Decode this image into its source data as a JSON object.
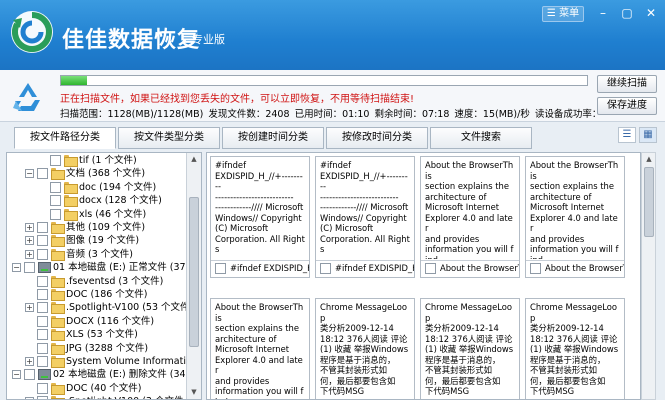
{
  "app": {
    "name": "佳佳数据恢复",
    "edition": "专业版",
    "menu_label": "菜单",
    "window_controls": [
      "minimize-icon",
      "maximize-icon",
      "close-icon"
    ]
  },
  "colors": {
    "titlebar": "#1f7fd0",
    "warning": "#d01414",
    "progress": "#2fb52f"
  },
  "scan": {
    "progress_fraction": 0.05,
    "warning": "正在扫描文件，如果已经找到您丢失的文件，可以立即恢复，不用等待扫描结束!",
    "stats": [
      "扫描范围：1128(MB)/1128(MB)",
      "发现文件数：2408",
      "已用时间：01:10",
      "剩余时间：07:18",
      "速度：15(MB)/秒",
      "读设备成功率："
    ],
    "continue_label": "继续扫描",
    "save_progress_label": "保存进度"
  },
  "tabs": [
    "按文件路径分类",
    "按文件类型分类",
    "按创建时间分类",
    "按修改时间分类",
    "文件搜索"
  ],
  "active_tab": 0,
  "view_icons": [
    "list-view-icon",
    "thumbnail-view-icon"
  ],
  "tree": [
    {
      "label": "tif  (1 个文件)",
      "icon": "folder",
      "depth": 3,
      "expand": ""
    },
    {
      "label": "文档  (368 个文件)",
      "icon": "folder",
      "depth": 2,
      "expand": "−"
    },
    {
      "label": "doc  (194 个文件)",
      "icon": "folder",
      "depth": 3,
      "expand": ""
    },
    {
      "label": "docx  (128 个文件)",
      "icon": "folder",
      "depth": 3,
      "expand": ""
    },
    {
      "label": "xls  (46 个文件)",
      "icon": "folder",
      "depth": 3,
      "expand": ""
    },
    {
      "label": "其他  (109 个文件)",
      "icon": "folder",
      "depth": 2,
      "expand": "+"
    },
    {
      "label": "图像  (19 个文件)",
      "icon": "folder",
      "depth": 2,
      "expand": "+"
    },
    {
      "label": "音频  (3 个文件)",
      "icon": "folder",
      "depth": 2,
      "expand": "+"
    },
    {
      "label": "01 本地磁盘 (E:) 正常文件 (37",
      "icon": "drive",
      "depth": 1,
      "expand": "−"
    },
    {
      "label": ".fseventsd  (3 个文件)",
      "icon": "folder",
      "depth": 2,
      "expand": ""
    },
    {
      "label": "DOC  (186 个文件)",
      "icon": "folder",
      "depth": 2,
      "expand": ""
    },
    {
      "label": ".Spotlight-V100  (53 个文件",
      "icon": "folder",
      "depth": 2,
      "expand": "+"
    },
    {
      "label": "DOCX  (116 个文件)",
      "icon": "folder",
      "depth": 2,
      "expand": ""
    },
    {
      "label": "XLS  (53 个文件)",
      "icon": "folder",
      "depth": 2,
      "expand": ""
    },
    {
      "label": "JPG  (3288 个文件)",
      "icon": "folder",
      "depth": 2,
      "expand": ""
    },
    {
      "label": "System Volume Information",
      "icon": "folder",
      "depth": 2,
      "expand": "+"
    },
    {
      "label": "02 本地磁盘 (E:) 删除文件 (34",
      "icon": "drive",
      "depth": 1,
      "expand": "−"
    },
    {
      "label": "DOC  (40 个文件)",
      "icon": "folder",
      "depth": 2,
      "expand": ""
    },
    {
      "label": ".Spotlight-V100  (3 个文件",
      "icon": "folder",
      "depth": 2,
      "expand": "+"
    }
  ],
  "files": [
    {
      "preview": "#ifndef\nEXDISPID_H_//+---------\n--------------------------\n------------//// Microsoft\nWindows// Copyright\n(C) Microsoft\nCorporation. All Rights",
      "name": "#ifndef EXDISPID_H_"
    },
    {
      "preview": "#ifndef\nEXDISPID_H_//+---------\n--------------------------\n------------//// Microsoft\nWindows// Copyright\n(C) Microsoft\nCorporation. All Rights",
      "name": "#ifndef EXDISPID_H_"
    },
    {
      "preview": "About the BrowserThis\nsection explains the\narchitecture of\nMicrosoft Internet\nExplorer 4.0 and later\nand provides\ninformation you will find\nhelpful when reusing",
      "name": "About the BrowserThis"
    },
    {
      "preview": "About the BrowserThis\nsection explains the\narchitecture of\nMicrosoft Internet\nExplorer 4.0 and later\nand provides\ninformation you will find\nhelpful when reusing",
      "name": "About the BrowserThis"
    },
    {
      "preview": "About the BrowserThis\nsection explains the\narchitecture of\nMicrosoft Internet\nExplorer 4.0 and later\nand provides\ninformation you will find\nhelpful when reusing",
      "name": "About the BrowserThis"
    },
    {
      "preview": "Chrome MessageLoop\n类分析2009-12-14\n18:12 376人阅读 评论\n(1) 收藏 举报Windows\n程序是基于消息的，\n不管其封装形式如\n何，最后都要包含如\n下代码MSG",
      "name": "Chrome MessageLoop"
    },
    {
      "preview": "Chrome MessageLoop\n类分析2009-12-14\n18:12 376人阅读 评论\n(1) 收藏 举报Windows\n程序是基于消息的，\n不管其封装形式如\n何，最后都要包含如\n下代码MSG",
      "name": "Chrome MessageLoop"
    },
    {
      "preview": "Chrome MessageLoop\n类分析2009-12-14\n18:12 376人阅读 评论\n(1) 收藏 举报Windows\n程序是基于消息的，\n不管其封装形式如\n何，最后都要包含如\n下代码MSG",
      "name": "Chrome MessageLoop"
    }
  ]
}
